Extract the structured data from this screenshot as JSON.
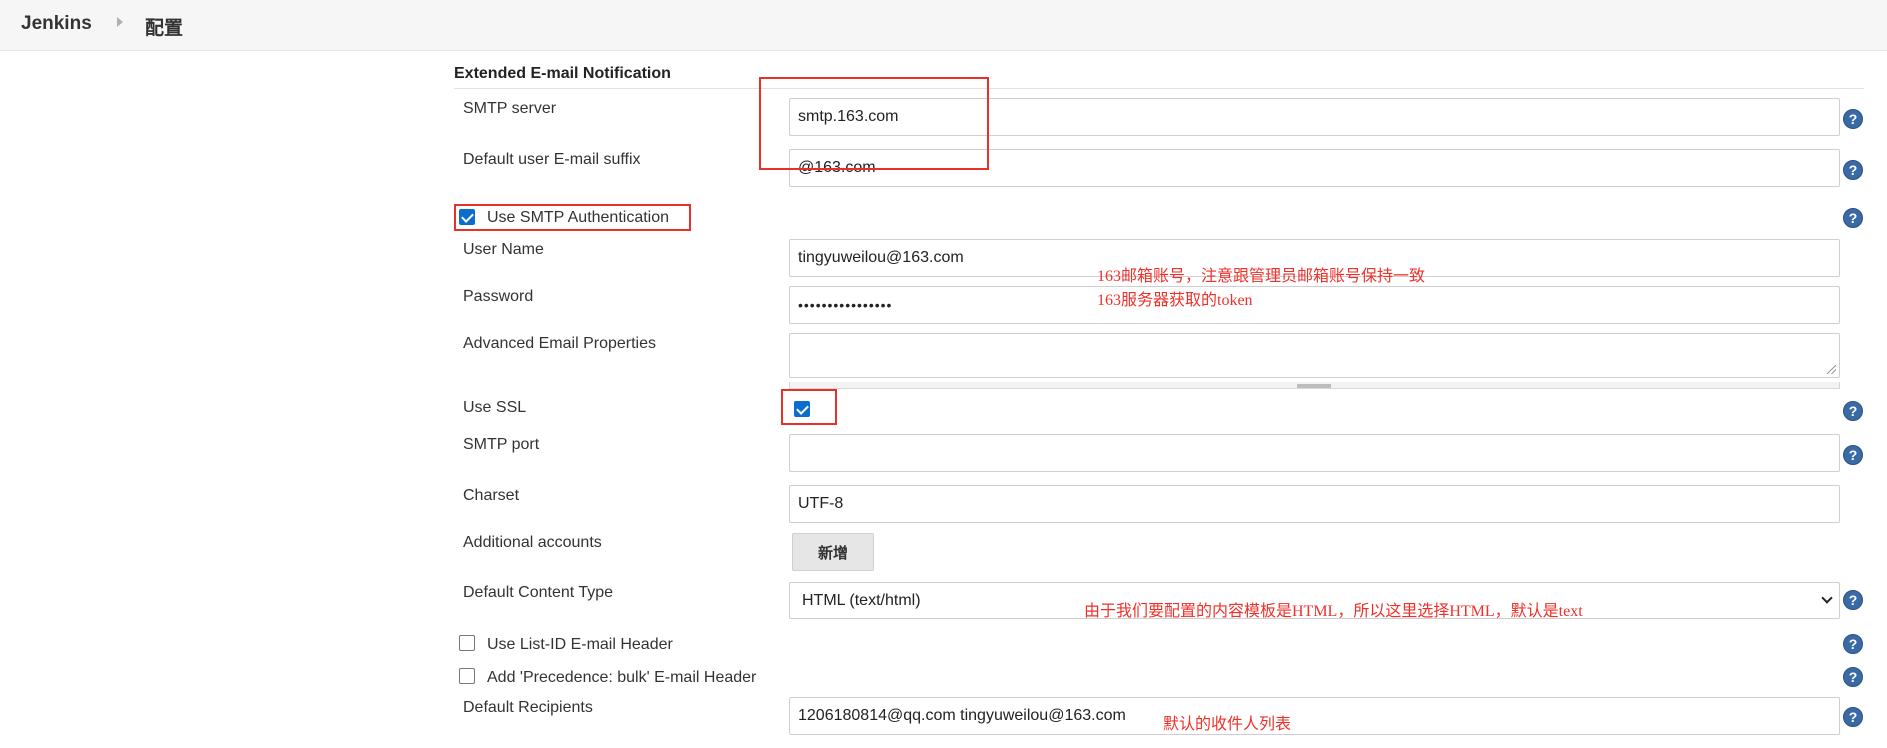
{
  "breadcrumb": {
    "home": "Jenkins",
    "page": "配置"
  },
  "section": {
    "title": "Extended E-mail Notification"
  },
  "fields": {
    "smtp_server": {
      "label": "SMTP server",
      "value": "smtp.163.com"
    },
    "email_suffix": {
      "label": "Default user E-mail suffix",
      "value": "@163.com"
    },
    "use_smtp_auth": {
      "label": "Use SMTP Authentication",
      "checked": true
    },
    "user_name": {
      "label": "User Name",
      "value": "tingyuweilou@163.com"
    },
    "password": {
      "label": "Password",
      "value": "••••••••••••••••"
    },
    "advanced_props": {
      "label": "Advanced Email Properties",
      "value": ""
    },
    "use_ssl": {
      "label": "Use SSL",
      "checked": true
    },
    "smtp_port": {
      "label": "SMTP port",
      "value": ""
    },
    "charset": {
      "label": "Charset",
      "value": "UTF-8"
    },
    "additional_accounts": {
      "label": "Additional accounts",
      "button": "新增"
    },
    "content_type": {
      "label": "Default Content Type",
      "value": "HTML (text/html)"
    },
    "list_id_header": {
      "label": "Use List-ID E-mail Header",
      "checked": false
    },
    "precedence_header": {
      "label": "Add 'Precedence: bulk' E-mail Header",
      "checked": false
    },
    "default_recipients": {
      "label": "Default Recipients",
      "value": "1206180814@qq.com tingyuweilou@163.com"
    }
  },
  "help_icon": "?",
  "annotations": {
    "account_note": "163邮箱账号，注意跟管理员邮箱账号保持一致",
    "token_note": "163服务器获取的token",
    "content_type_note": "由于我们要配置的内容模板是HTML，所以这里选择HTML，默认是text",
    "recipients_note": "默认的收件人列表"
  },
  "colors": {
    "annotation": "#f0302a",
    "help": "#3a6aa5",
    "checkbox": "#0a6ed1"
  }
}
